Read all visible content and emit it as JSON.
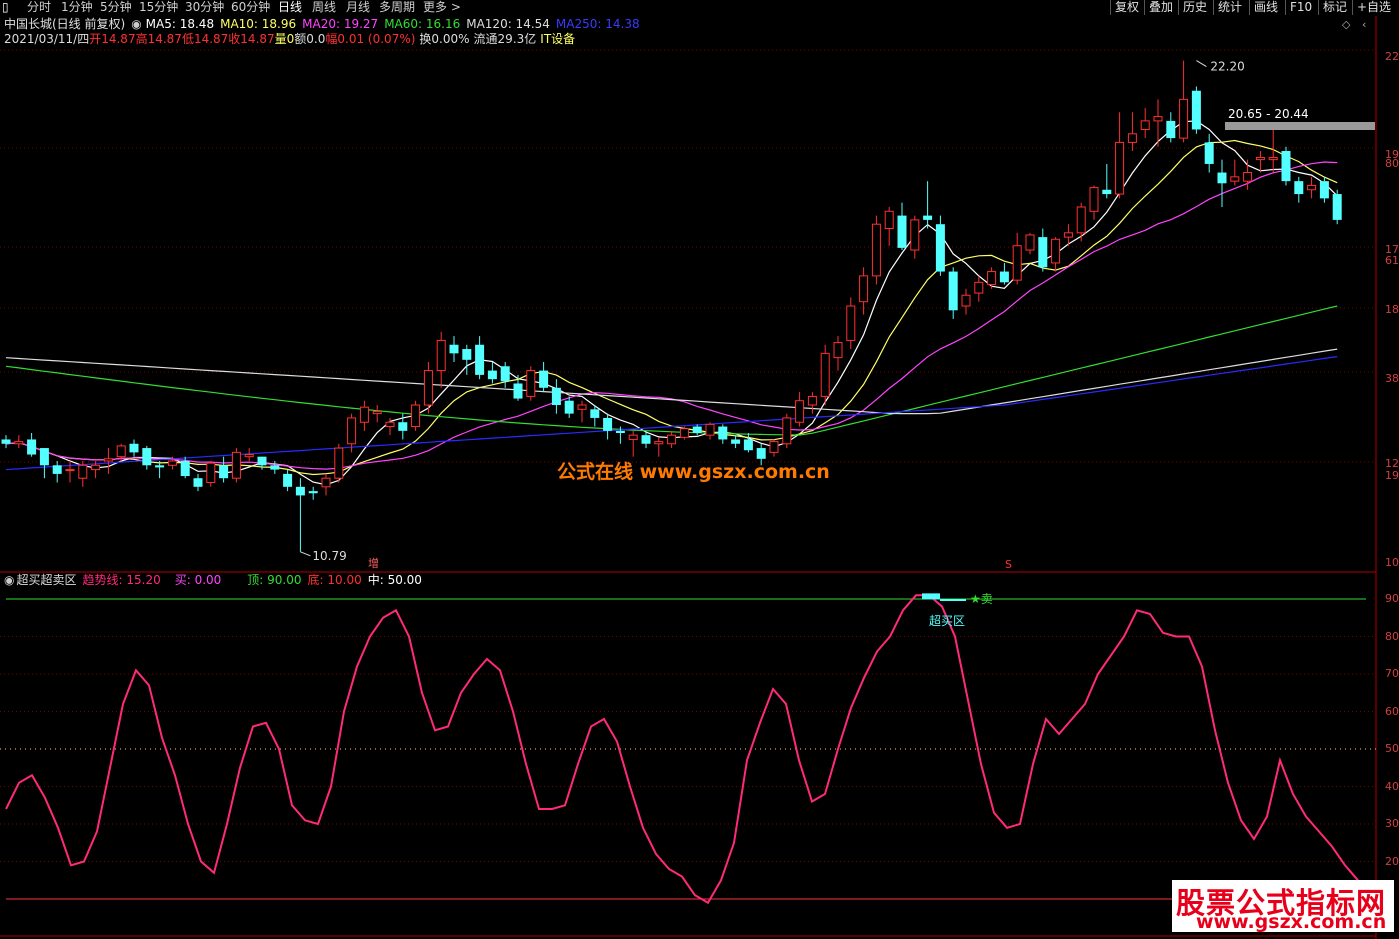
{
  "colors": {
    "up": "#ff3030",
    "down": "#54ffff",
    "ma5": "#ffffff",
    "ma10": "#ffff66",
    "ma20": "#ff44ff",
    "ma60": "#33dd33",
    "ma120": "#dddddd",
    "ma250": "#2a2aff",
    "trend": "#ff2a78",
    "grid": "#8b0000"
  },
  "toolbar": {
    "tabs": [
      "分时",
      "1分钟",
      "5分钟",
      "15分钟",
      "30分钟",
      "60分钟",
      "日线",
      "周线",
      "月线",
      "多周期",
      "更多 >"
    ],
    "active": "日线",
    "right_buttons": [
      "复权",
      "叠加",
      "历史",
      "统计",
      "画线",
      "F10",
      "标记",
      "+自选"
    ]
  },
  "info": {
    "stock": "中国长城(日线 前复权)",
    "ma5": "MA5: 18.48",
    "ma10": "MA10: 18.96",
    "ma20": "MA20: 19.27",
    "ma60": "MA60: 16.16",
    "ma120": "MA120: 14.54",
    "ma250": "MA250: 14.38",
    "date": "2021/03/11/四",
    "open": "开14.87",
    "high": "高14.87",
    "low": "低14.87",
    "close": "收14.87",
    "volume": "量0",
    "amount": "额0.0",
    "change": "幅0.01 (0.07%)",
    "turnover": "换0.00%",
    "float": "流通29.3亿",
    "sector": "IT设备"
  },
  "indicator": {
    "name": "超买超卖区",
    "trend": "趋势线: 15.20",
    "buy": "买: 0.00",
    "top": "顶: 90.00",
    "bottom": "底: 10.00",
    "mid": "中: 50.00",
    "zone_label": "超买区",
    "sell_label": "★卖"
  },
  "annotations": {
    "high_price": "22.20",
    "low_price": "10.79",
    "range_label": "20.65 - 20.44",
    "add_mark": "增",
    "s_mark": "S"
  },
  "right_axis": {
    "main": [
      "22",
      "19",
      "80",
      "17",
      "61",
      "18",
      "38",
      "12",
      "19",
      "10"
    ],
    "indicator": [
      "90",
      "80",
      "70",
      "60",
      "50",
      "40",
      "30",
      "20"
    ]
  },
  "watermark": "公式在线  www.gszx.com.cn",
  "logo": {
    "line1": "股票公式指标网",
    "line2": "www.gszx.com.cn"
  },
  "chart_data": {
    "type": "candlestick",
    "price_range": [
      10.4,
      22.6
    ],
    "candles": [
      [
        13.4,
        13.5,
        13.2,
        13.3
      ],
      [
        13.3,
        13.5,
        13.2,
        13.35
      ],
      [
        13.4,
        13.55,
        13.0,
        13.05
      ],
      [
        13.2,
        13.2,
        12.5,
        12.8
      ],
      [
        12.8,
        12.9,
        12.4,
        12.6
      ],
      [
        12.7,
        12.9,
        12.4,
        12.7
      ],
      [
        12.5,
        12.9,
        12.3,
        12.8
      ],
      [
        12.7,
        12.9,
        12.5,
        12.8
      ],
      [
        12.9,
        13.2,
        12.6,
        12.95
      ],
      [
        13.0,
        13.3,
        12.9,
        13.25
      ],
      [
        13.3,
        13.4,
        13.0,
        13.1
      ],
      [
        13.2,
        13.25,
        12.7,
        12.8
      ],
      [
        12.8,
        12.9,
        12.5,
        12.75
      ],
      [
        12.8,
        13.0,
        12.7,
        12.9
      ],
      [
        12.9,
        13.0,
        12.5,
        12.55
      ],
      [
        12.5,
        12.6,
        12.2,
        12.3
      ],
      [
        12.4,
        12.9,
        12.3,
        12.85
      ],
      [
        12.8,
        13.0,
        12.4,
        12.5
      ],
      [
        12.5,
        13.2,
        12.4,
        13.1
      ],
      [
        13.0,
        13.2,
        12.9,
        13.05
      ],
      [
        13.0,
        13.0,
        12.7,
        12.8
      ],
      [
        12.8,
        12.9,
        12.6,
        12.7
      ],
      [
        12.6,
        12.7,
        12.2,
        12.3
      ],
      [
        12.3,
        12.5,
        10.79,
        12.1
      ],
      [
        12.2,
        12.3,
        12.0,
        12.15
      ],
      [
        12.3,
        12.6,
        12.1,
        12.5
      ],
      [
        12.5,
        13.3,
        12.4,
        13.2
      ],
      [
        13.3,
        14.0,
        13.1,
        13.9
      ],
      [
        13.8,
        14.3,
        13.6,
        14.15
      ],
      [
        14.0,
        14.2,
        13.8,
        14.05
      ],
      [
        13.7,
        13.9,
        13.5,
        13.8
      ],
      [
        13.8,
        14.0,
        13.4,
        13.6
      ],
      [
        13.7,
        14.3,
        13.6,
        14.2
      ],
      [
        14.2,
        15.2,
        14.0,
        15.0
      ],
      [
        15.0,
        15.9,
        14.6,
        15.7
      ],
      [
        15.6,
        15.8,
        15.2,
        15.4
      ],
      [
        15.5,
        15.6,
        14.9,
        15.25
      ],
      [
        15.6,
        15.8,
        14.8,
        14.9
      ],
      [
        15.0,
        15.2,
        14.7,
        14.8
      ],
      [
        15.1,
        15.2,
        14.6,
        14.75
      ],
      [
        14.7,
        14.9,
        14.3,
        14.35
      ],
      [
        14.4,
        15.1,
        14.3,
        15.0
      ],
      [
        15.0,
        15.2,
        14.5,
        14.6
      ],
      [
        14.6,
        14.8,
        14.0,
        14.2
      ],
      [
        14.3,
        14.4,
        13.9,
        14.0
      ],
      [
        14.1,
        14.3,
        13.8,
        14.2
      ],
      [
        14.1,
        14.2,
        13.7,
        13.9
      ],
      [
        13.9,
        14.0,
        13.4,
        13.6
      ],
      [
        13.6,
        13.7,
        13.3,
        13.55
      ],
      [
        13.4,
        13.6,
        13.0,
        13.5
      ],
      [
        13.5,
        13.6,
        13.2,
        13.3
      ],
      [
        13.3,
        13.45,
        13.0,
        13.35
      ],
      [
        13.3,
        13.6,
        13.2,
        13.5
      ],
      [
        13.45,
        13.7,
        13.4,
        13.65
      ],
      [
        13.7,
        13.75,
        13.5,
        13.55
      ],
      [
        13.5,
        13.8,
        13.4,
        13.75
      ],
      [
        13.7,
        13.75,
        13.3,
        13.4
      ],
      [
        13.4,
        13.5,
        13.2,
        13.3
      ],
      [
        13.4,
        13.55,
        13.1,
        13.15
      ],
      [
        13.2,
        13.3,
        12.8,
        12.95
      ],
      [
        13.1,
        13.4,
        13.0,
        13.35
      ],
      [
        13.3,
        14.0,
        13.2,
        13.9
      ],
      [
        13.8,
        14.5,
        13.7,
        14.3
      ],
      [
        14.2,
        14.5,
        14.0,
        14.4
      ],
      [
        14.4,
        15.6,
        14.2,
        15.4
      ],
      [
        15.3,
        15.8,
        15.0,
        15.65
      ],
      [
        15.7,
        16.7,
        15.5,
        16.5
      ],
      [
        16.6,
        17.4,
        16.3,
        17.2
      ],
      [
        17.2,
        18.6,
        17.0,
        18.4
      ],
      [
        18.3,
        18.8,
        17.9,
        18.7
      ],
      [
        18.6,
        18.9,
        17.8,
        17.85
      ],
      [
        17.8,
        18.6,
        17.6,
        18.5
      ],
      [
        18.6,
        19.4,
        18.3,
        18.5
      ],
      [
        18.4,
        18.6,
        17.2,
        17.3
      ],
      [
        17.3,
        17.4,
        16.2,
        16.4
      ],
      [
        16.5,
        16.9,
        16.3,
        16.75
      ],
      [
        16.8,
        17.2,
        16.6,
        17.05
      ],
      [
        17.0,
        17.4,
        16.9,
        17.3
      ],
      [
        17.3,
        17.5,
        17.0,
        17.05
      ],
      [
        17.1,
        18.2,
        17.0,
        17.9
      ],
      [
        17.8,
        18.2,
        17.7,
        18.15
      ],
      [
        18.1,
        18.3,
        17.3,
        17.4
      ],
      [
        17.5,
        18.1,
        17.3,
        18.05
      ],
      [
        18.1,
        18.4,
        17.9,
        18.2
      ],
      [
        18.2,
        18.9,
        18.0,
        18.8
      ],
      [
        18.7,
        19.3,
        18.5,
        19.25
      ],
      [
        19.2,
        19.8,
        19.0,
        19.1
      ],
      [
        19.1,
        21.0,
        19.0,
        20.3
      ],
      [
        20.3,
        21.0,
        20.1,
        20.5
      ],
      [
        20.6,
        21.1,
        20.4,
        20.8
      ],
      [
        20.8,
        21.3,
        20.2,
        20.9
      ],
      [
        20.8,
        21.0,
        20.3,
        20.4
      ],
      [
        20.4,
        22.2,
        20.3,
        21.3
      ],
      [
        21.5,
        21.6,
        20.5,
        20.6
      ],
      [
        20.3,
        20.5,
        19.6,
        19.8
      ],
      [
        19.6,
        19.9,
        18.8,
        19.35
      ],
      [
        19.4,
        19.9,
        19.3,
        19.5
      ],
      [
        19.4,
        19.9,
        19.2,
        19.6
      ],
      [
        19.9,
        20.1,
        19.6,
        19.95
      ],
      [
        19.9,
        20.6,
        19.6,
        19.95
      ],
      [
        20.1,
        20.2,
        19.3,
        19.4
      ],
      [
        19.4,
        19.5,
        18.9,
        19.1
      ],
      [
        19.2,
        19.5,
        19.0,
        19.3
      ],
      [
        19.4,
        19.5,
        18.9,
        19.0
      ],
      [
        19.1,
        19.2,
        18.4,
        18.5
      ]
    ],
    "indicator_range": [
      10,
      95
    ],
    "trend_values": [
      34,
      41,
      43,
      37,
      29,
      19,
      20,
      28,
      45,
      62,
      71,
      67,
      53,
      43,
      30,
      20,
      17,
      30,
      45,
      56,
      57,
      50,
      35,
      31,
      30,
      40,
      60,
      72,
      80,
      85,
      87,
      80,
      65,
      55,
      56,
      65,
      70,
      74,
      71,
      60,
      46,
      34,
      34,
      35,
      46,
      56,
      58,
      52,
      40,
      29,
      22,
      18,
      16,
      11,
      9,
      15,
      25,
      47,
      57,
      66,
      62,
      47,
      36,
      38,
      50,
      61,
      69,
      76,
      80,
      87,
      91,
      91,
      88,
      80,
      63,
      46,
      33,
      29,
      30,
      46,
      58,
      54,
      58,
      62,
      70,
      75,
      80,
      87,
      86,
      81,
      80,
      80,
      72,
      55,
      41,
      31,
      26,
      32,
      47,
      38,
      32,
      28,
      24,
      19,
      15
    ],
    "title": "中国长城(日线 前复权)"
  }
}
